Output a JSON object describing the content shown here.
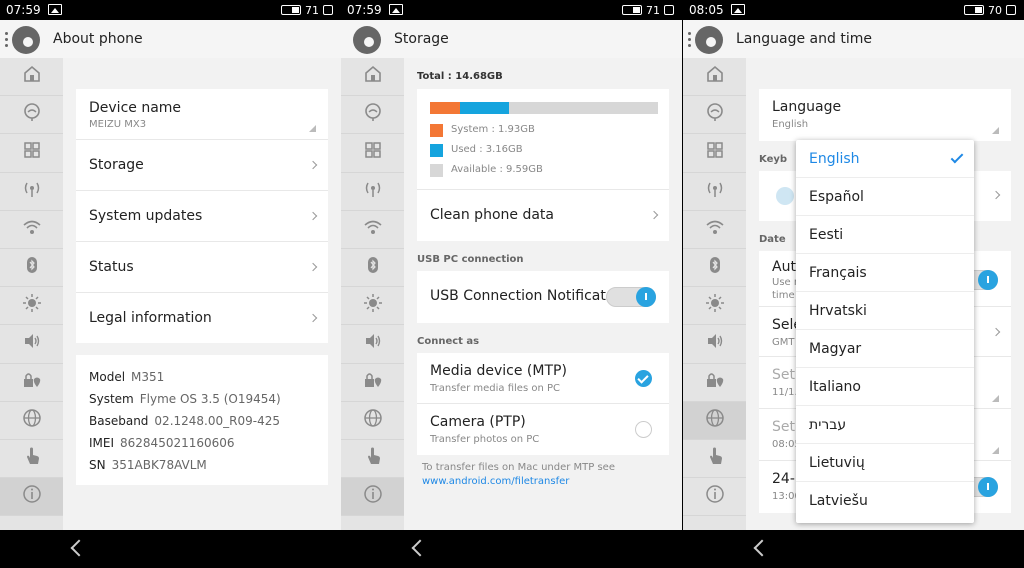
{
  "panels": [
    {
      "status": {
        "time": "07:59",
        "battery": "71"
      },
      "title": "About phone",
      "rows": [
        {
          "label": "Device name",
          "sub": "MEIZU MX3"
        },
        {
          "label": "Storage"
        },
        {
          "label": "System updates"
        },
        {
          "label": "Status"
        },
        {
          "label": "Legal information"
        }
      ],
      "info": [
        {
          "key": "Model",
          "value": "M351"
        },
        {
          "key": "System",
          "value": "Flyme OS 3.5 (O19454)"
        },
        {
          "key": "Baseband",
          "value": "02.1248.00_R09-425"
        },
        {
          "key": "IMEI",
          "value": "862845021160606"
        },
        {
          "key": "SN",
          "value": "351ABK78AVLM"
        }
      ]
    },
    {
      "status": {
        "time": "07:59",
        "battery": "71"
      },
      "title": "Storage",
      "total": "Total : 14.68GB",
      "legend": [
        {
          "label": "System : 1.93GB",
          "color": "#f37735"
        },
        {
          "label": "Used : 3.16GB",
          "color": "#15a4de"
        },
        {
          "label": "Available : 9.59GB",
          "color": "#d7d7d7"
        }
      ],
      "clean": "Clean phone data",
      "usb_section": "USB PC connection",
      "usb_notify": "USB Connection Notificat..",
      "connect_section": "Connect as",
      "mtp": {
        "label": "Media device (MTP)",
        "sub": "Transfer media files on PC"
      },
      "ptp": {
        "label": "Camera (PTP)",
        "sub": "Transfer photos on PC"
      },
      "note": "To transfer files on Mac under MTP see",
      "link": "www.android.com/filetransfer"
    },
    {
      "status": {
        "time": "08:05",
        "battery": "70"
      },
      "title": "Language and time",
      "language": {
        "label": "Language",
        "sub": "English"
      },
      "keyboard_section": "Keyb",
      "date_section": "Date",
      "rows": [
        {
          "label": "Auto",
          "sub1": "Use n",
          "sub2": "time"
        },
        {
          "label": "Sele",
          "sub1": "GMT"
        },
        {
          "label": "Set",
          "sub1": "11/1."
        },
        {
          "label": "Set",
          "sub1": "08:05"
        },
        {
          "label": "24-h",
          "sub1": "13:00"
        }
      ],
      "languages": [
        "English",
        "Español",
        "Eesti",
        "Français",
        "Hrvatski",
        "Magyar",
        "Italiano",
        "עברית",
        "Lietuvių",
        "Latviešu"
      ],
      "selected_language": "English"
    }
  ],
  "sidebar_icons": [
    "home-icon",
    "theme-icon",
    "apps-grid-icon",
    "signal-icon",
    "wifi-icon",
    "bluetooth-icon",
    "brightness-icon",
    "volume-icon",
    "privacy-location-icon",
    "language-globe-icon",
    "touch-gesture-icon",
    "info-icon"
  ],
  "colors": {
    "accent": "#29a3e0",
    "system": "#f37735",
    "used": "#15a4de",
    "available": "#d7d7d7",
    "link": "#1e88e5"
  }
}
